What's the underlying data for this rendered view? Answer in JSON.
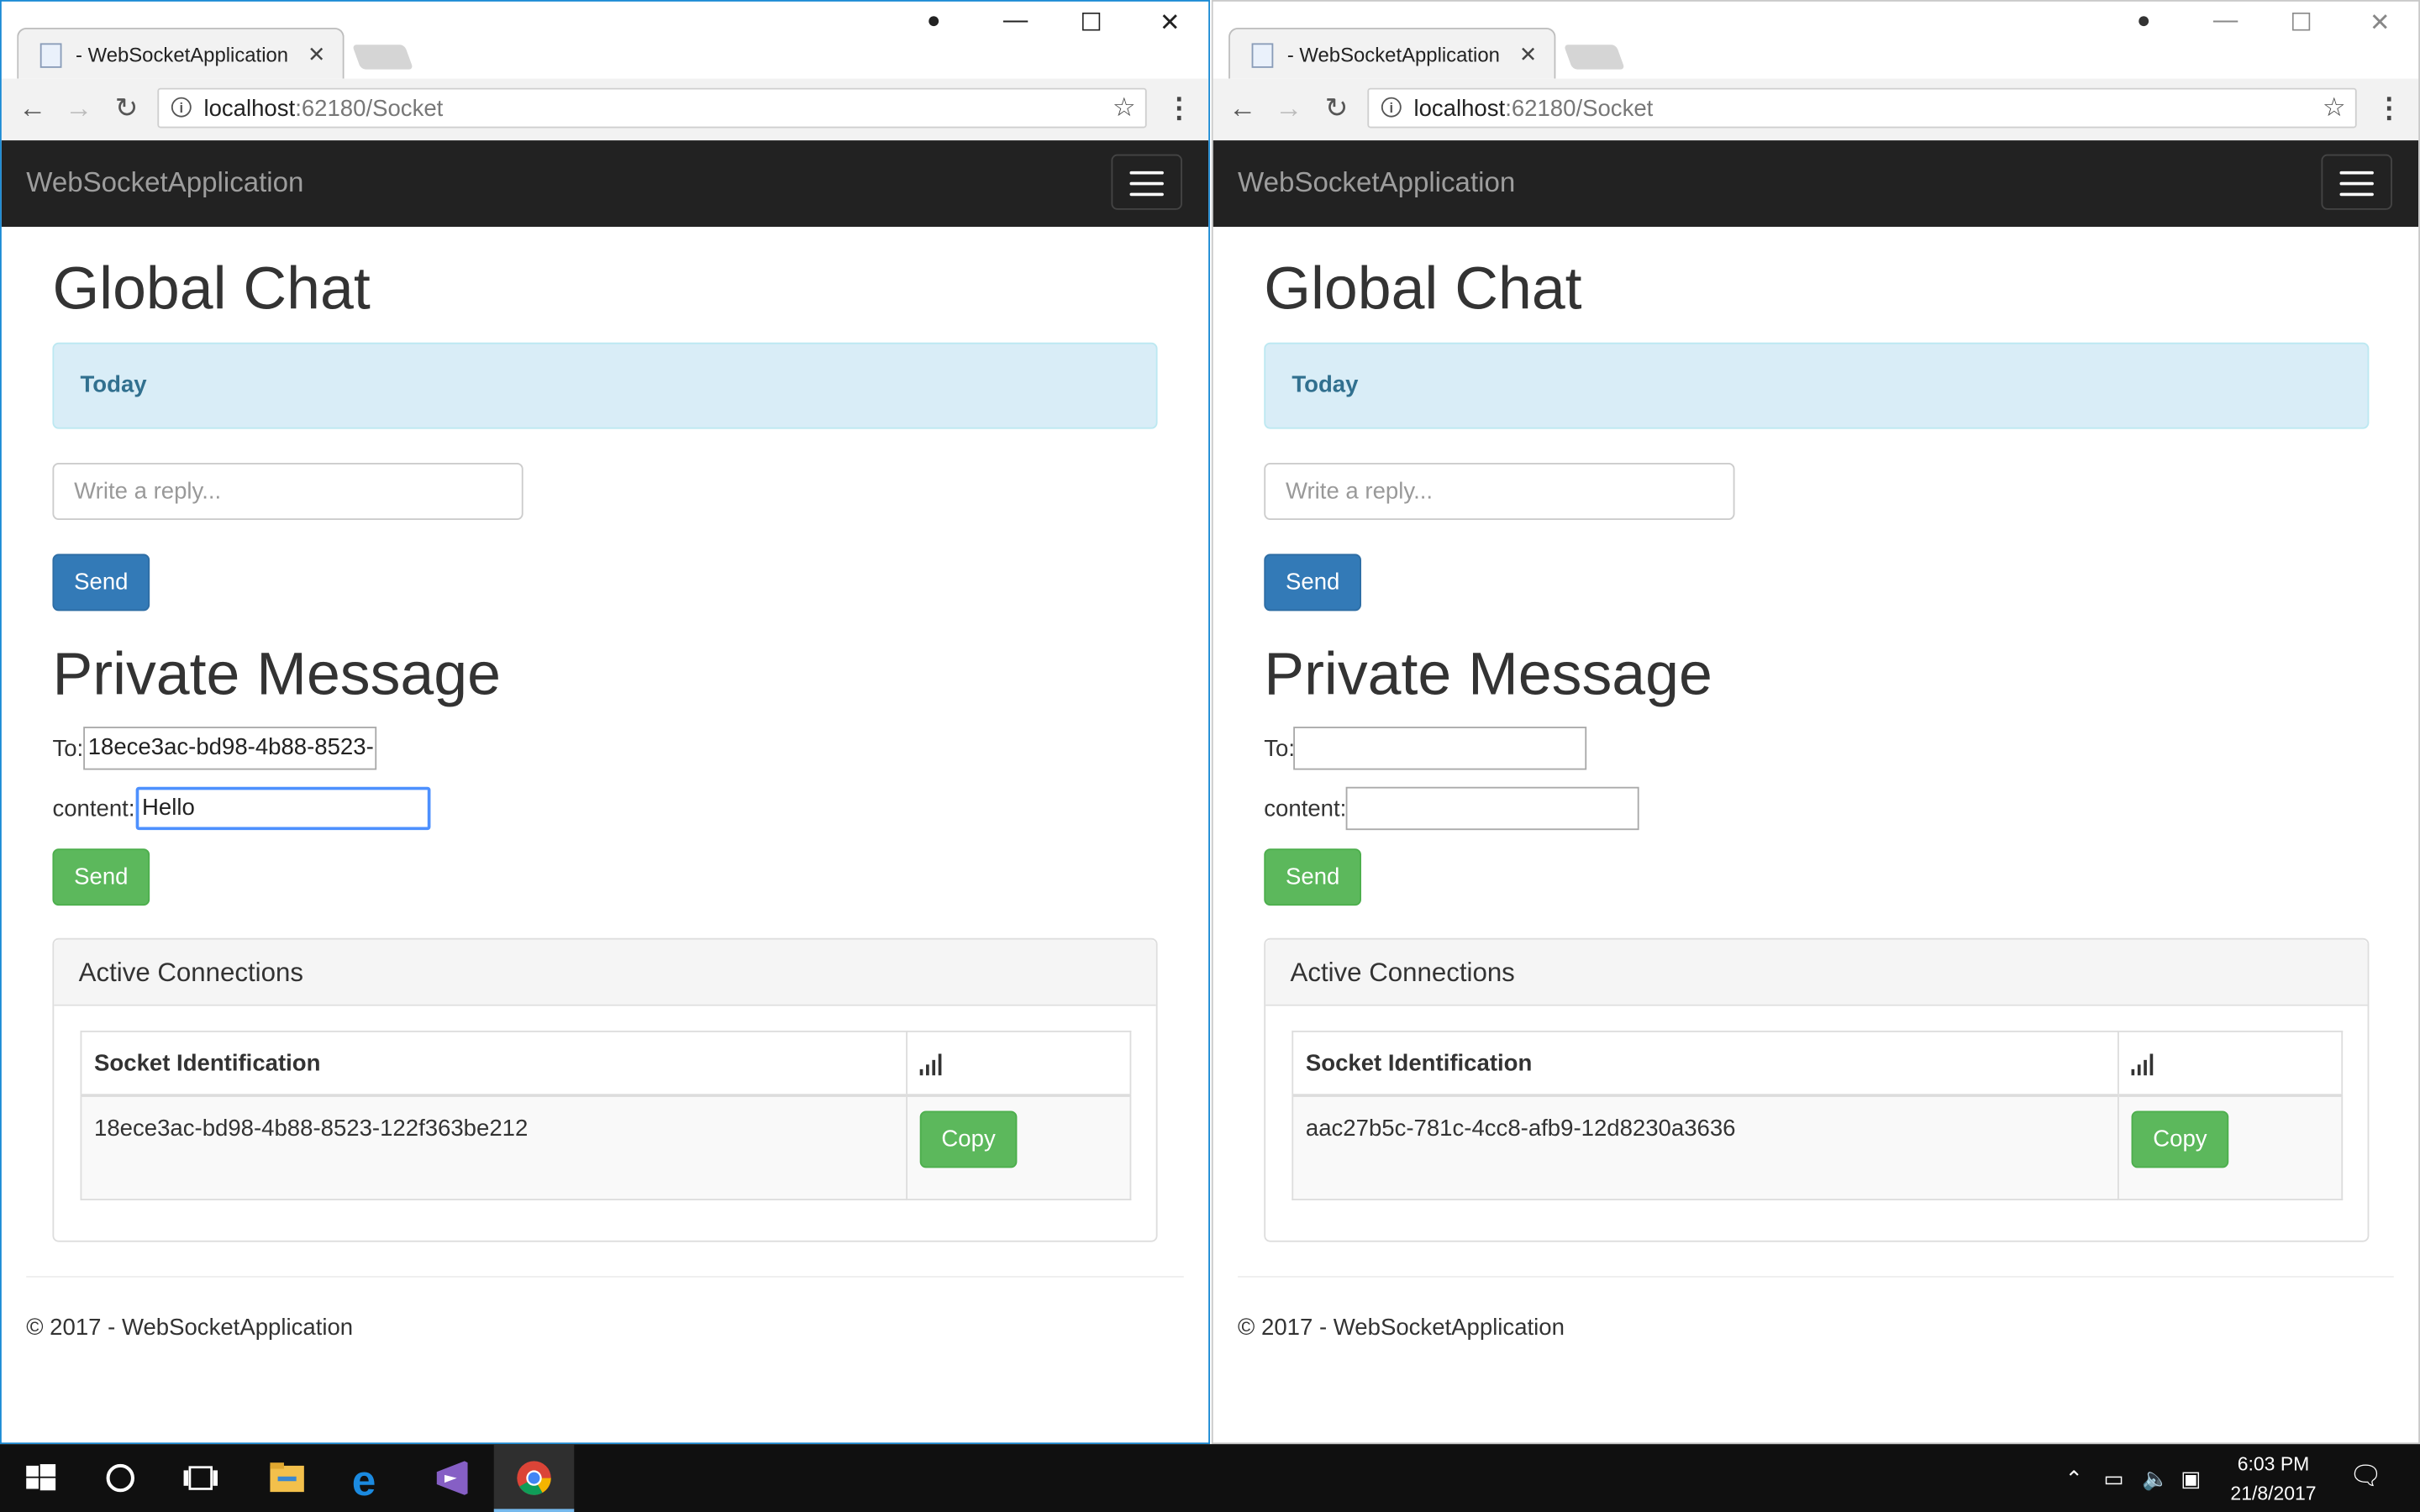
{
  "windows": [
    {
      "tab_title": "- WebSocketApplication",
      "address_host": "localhost",
      "address_rest": ":62180/Socket",
      "brand": "WebSocketApplication",
      "global_chat_heading": "Global Chat",
      "alert_text": "Today",
      "reply_placeholder": "Write a reply...",
      "send_label": "Send",
      "private_heading": "Private Message",
      "to_label": "To:",
      "to_value": "18ece3ac-bd98-4b88-8523-",
      "content_label": "content:",
      "content_value": "Hello",
      "private_send_label": "Send",
      "panel_title": "Active Connections",
      "col_socket": "Socket Identification",
      "socket_id": "18ece3ac-bd98-4b88-8523-122f363be212",
      "copy_label": "Copy",
      "footer": "© 2017 - WebSocketApplication"
    },
    {
      "tab_title": "- WebSocketApplication",
      "address_host": "localhost",
      "address_rest": ":62180/Socket",
      "brand": "WebSocketApplication",
      "global_chat_heading": "Global Chat",
      "alert_text": "Today",
      "reply_placeholder": "Write a reply...",
      "send_label": "Send",
      "private_heading": "Private Message",
      "to_label": "To:",
      "to_value": "",
      "content_label": "content:",
      "content_value": "",
      "private_send_label": "Send",
      "panel_title": "Active Connections",
      "col_socket": "Socket Identification",
      "socket_id": "aac27b5c-781c-4cc8-afb9-12d8230a3636",
      "copy_label": "Copy",
      "footer": "© 2017 - WebSocketApplication"
    }
  ],
  "taskbar": {
    "time": "6:03 PM",
    "date": "21/8/2017",
    "icons": [
      "windows-start-icon",
      "cortana-icon",
      "task-view-icon",
      "file-explorer-icon",
      "edge-icon",
      "visual-studio-icon",
      "chrome-icon"
    ]
  },
  "colors": {
    "navbar": "#222222",
    "primary": "#337ab7",
    "success": "#5cb85c",
    "alert_bg": "#d9edf7",
    "alert_text": "#31708f",
    "focus_border": "#4d90fe"
  }
}
